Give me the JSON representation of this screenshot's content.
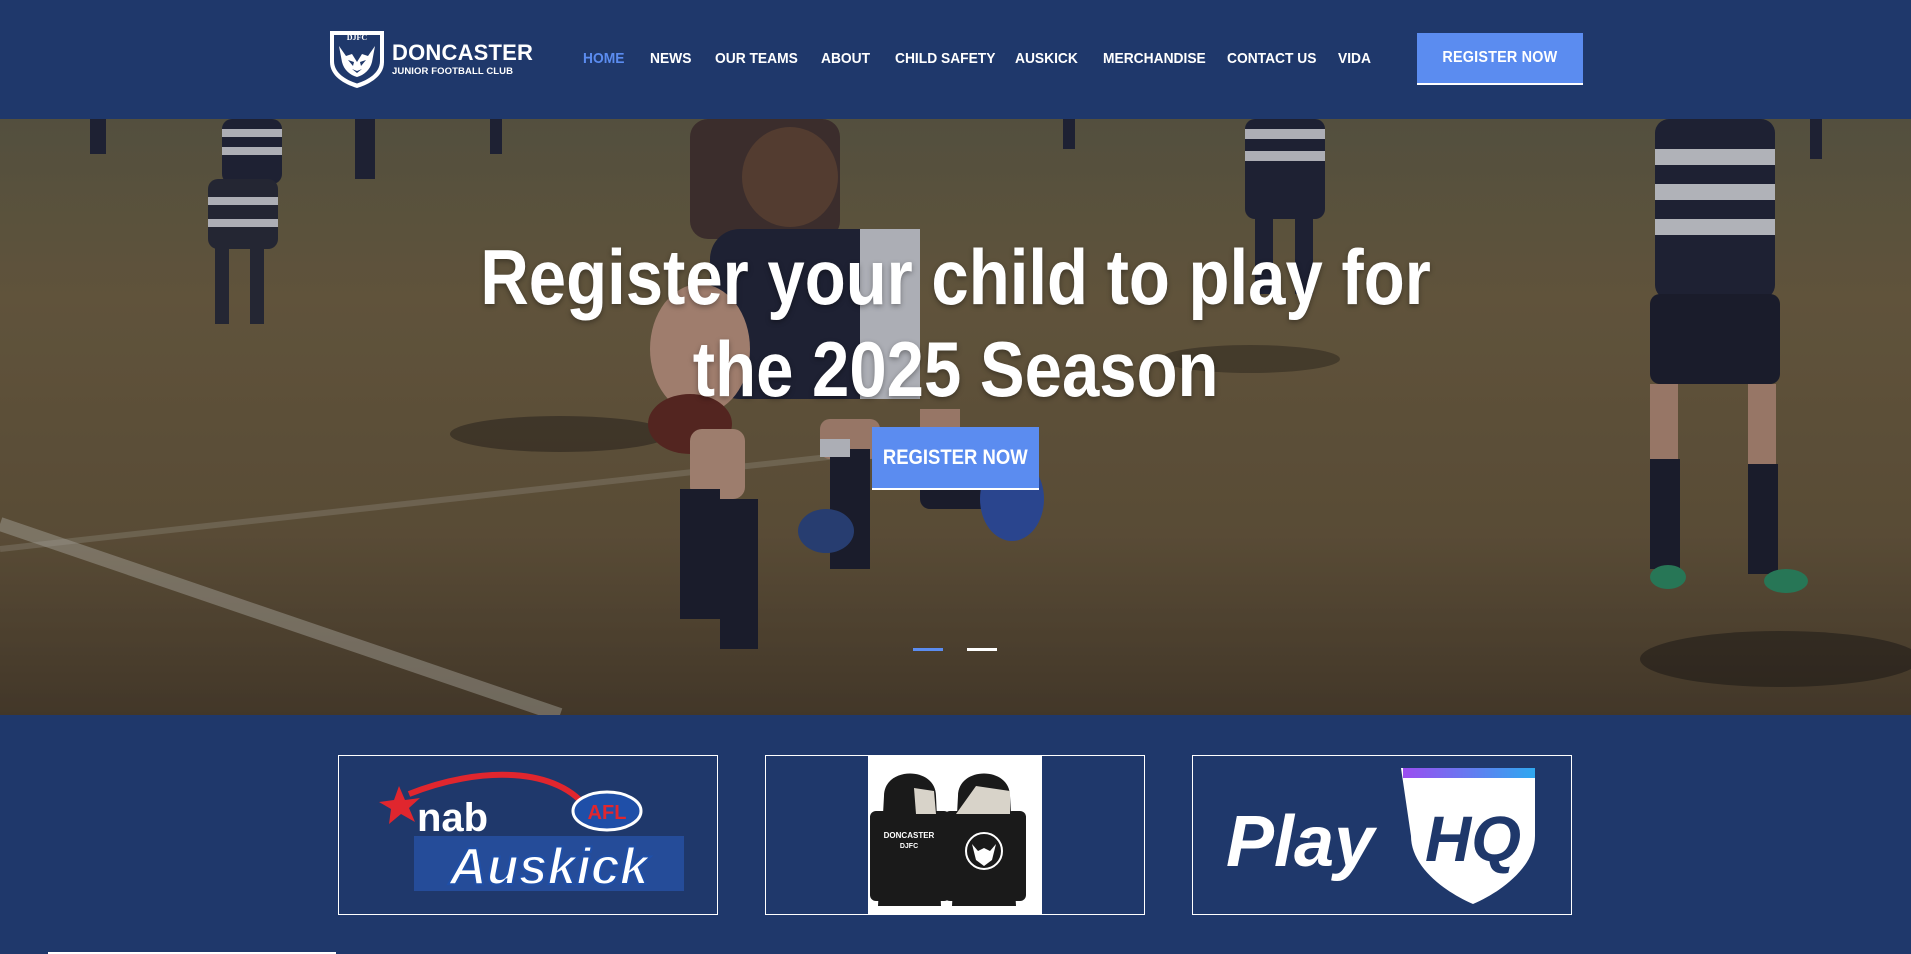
{
  "logo": {
    "badge": "DJFC",
    "name": "DONCASTER",
    "subtitle": "JUNIOR FOOTBALL CLUB"
  },
  "nav": {
    "items": [
      {
        "label": "HOME",
        "active": true
      },
      {
        "label": "NEWS"
      },
      {
        "label": "OUR TEAMS"
      },
      {
        "label": "ABOUT"
      },
      {
        "label": "CHILD SAFETY"
      },
      {
        "label": "AUSKICK"
      },
      {
        "label": "MERCHANDISE"
      },
      {
        "label": "CONTACT US"
      },
      {
        "label": "VIDA"
      }
    ]
  },
  "header": {
    "cta_label": "REGISTER NOW"
  },
  "hero": {
    "title_line1": "Register your child to play for",
    "title_line2": "the 2025 Season",
    "cta_label": "REGISTER NOW",
    "slides": 2,
    "active_slide": 1
  },
  "cards": [
    {
      "name": "nab-auskick",
      "logo_nab": "nab",
      "logo_afl": "AFL",
      "logo_auskick": "Auskick"
    },
    {
      "name": "merchandise",
      "hoodie_text": "DONCASTER",
      "hoodie_sub": "DJFC"
    },
    {
      "name": "playhq",
      "logo_play": "Play",
      "logo_hq": "HQ"
    }
  ],
  "colors": {
    "navy": "#1f386b",
    "accent": "#5b8cf0",
    "white": "#ffffff"
  }
}
